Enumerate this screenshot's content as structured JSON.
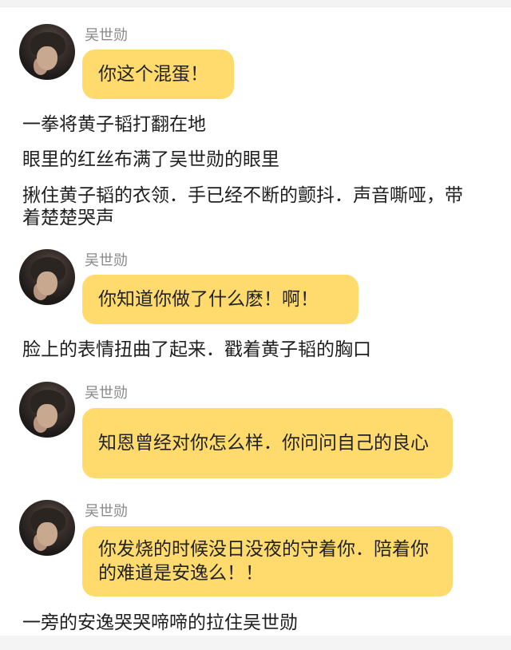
{
  "messages": [
    {
      "name": "吴世勋",
      "text": "你这个混蛋！"
    },
    {
      "name": "吴世勋",
      "text": "你知道你做了什么麽！啊！"
    },
    {
      "name": "吴世勋",
      "text": "知恩曾经对你怎么样．你问问自己的良心"
    },
    {
      "name": "吴世勋",
      "text": "你发烧的时候没日没夜的守着你．陪着你的难道是安逸么！！"
    }
  ],
  "narration": [
    "一拳将黄子韬打翻在地",
    "眼里的红丝布满了吴世勋的眼里",
    "揪住黄子韬的衣领．手已经不断的颤抖．声音嘶哑，带着楚楚哭声",
    "脸上的表情扭曲了起来．戳着黄子韬的胸口",
    "一旁的安逸哭哭啼啼的拉住吴世勋"
  ]
}
